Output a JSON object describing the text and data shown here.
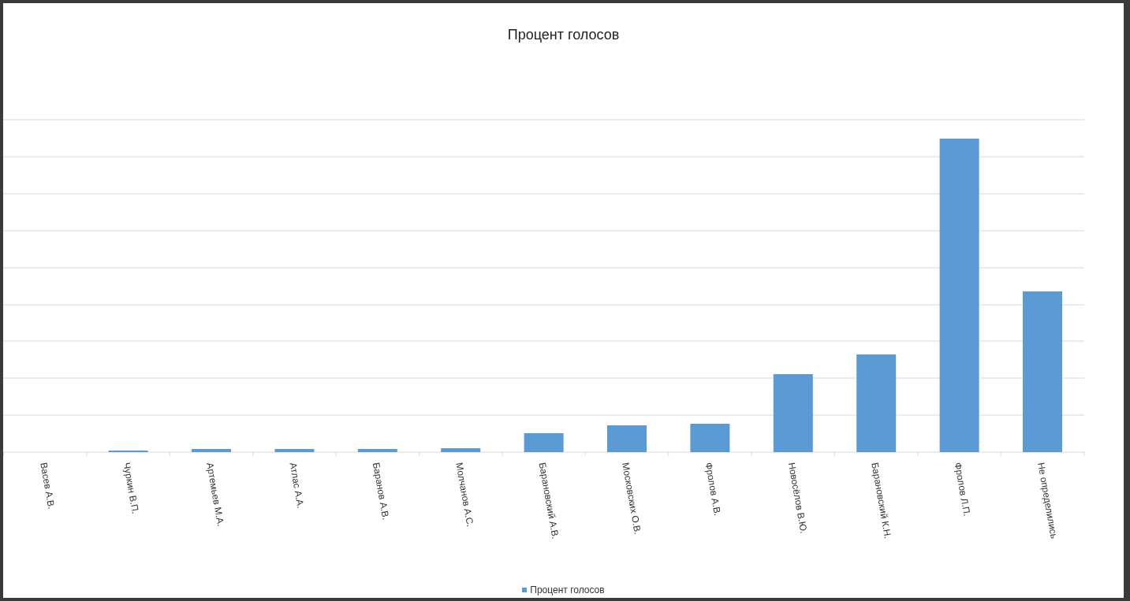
{
  "chart": {
    "title": "Процент голосов",
    "categories": [
      "Васев А.В.",
      "Чуркин В.П.",
      "Артемьев М.А.",
      "Атлас А.А.",
      "Баранов А.В.",
      "Молчанов А.С.",
      "Барановский А.В.",
      "Московских О.В.",
      "Фролов А.В.",
      "Новосёлов В.Ю.",
      "Барановский К.Н.",
      "Фролов Л.П.",
      "Не определились"
    ],
    "legend": "Процент голосов"
  }
}
